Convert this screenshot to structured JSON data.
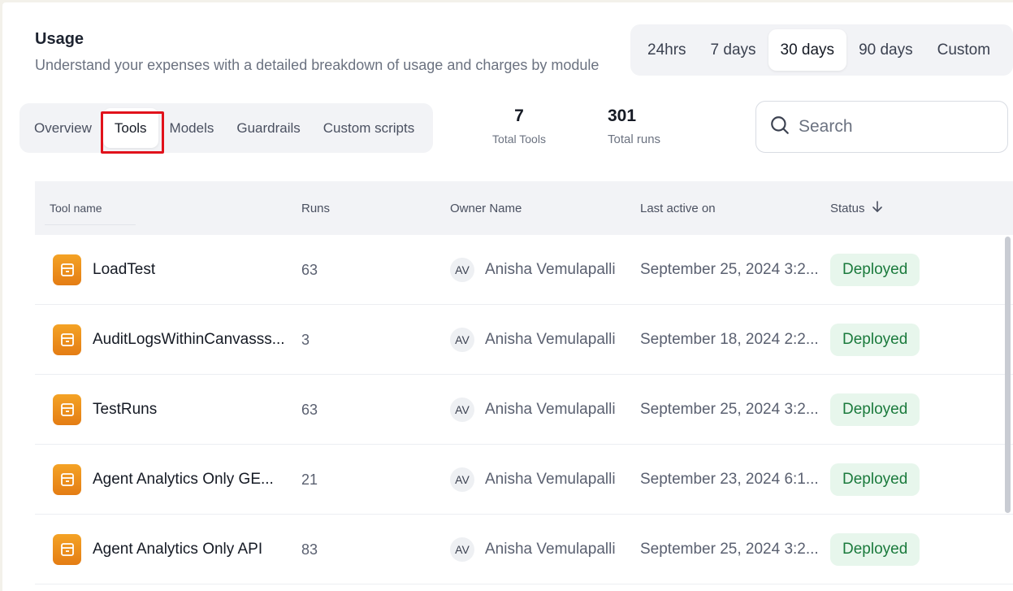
{
  "header": {
    "title": "Usage",
    "subtitle": "Understand your expenses with a detailed breakdown of usage and charges by module"
  },
  "time_range": {
    "options": [
      "24hrs",
      "7 days",
      "30 days",
      "90 days",
      "Custom"
    ],
    "selected": "30 days"
  },
  "tabs": {
    "items": [
      "Overview",
      "Tools",
      "Models",
      "Guardrails",
      "Custom scripts"
    ],
    "selected": "Tools"
  },
  "stats": {
    "total_tools": {
      "value": "7",
      "label": "Total Tools"
    },
    "total_runs": {
      "value": "301",
      "label": "Total runs"
    }
  },
  "search": {
    "placeholder": "Search",
    "value": ""
  },
  "table": {
    "columns": {
      "name": "Tool name",
      "runs": "Runs",
      "owner": "Owner Name",
      "last_active": "Last active on",
      "status": "Status"
    },
    "sort_icon": "arrow-down-icon",
    "rows": [
      {
        "name": "LoadTest",
        "runs": "63",
        "owner_initials": "AV",
        "owner": "Anisha Vemulapalli",
        "last_active": "September 25, 2024 3:2...",
        "status": "Deployed"
      },
      {
        "name": "AuditLogsWithinCanvasss...",
        "runs": "3",
        "owner_initials": "AV",
        "owner": "Anisha Vemulapalli",
        "last_active": "September 18, 2024 2:2...",
        "status": "Deployed"
      },
      {
        "name": "TestRuns",
        "runs": "63",
        "owner_initials": "AV",
        "owner": "Anisha Vemulapalli",
        "last_active": "September 25, 2024 3:2...",
        "status": "Deployed"
      },
      {
        "name": "Agent Analytics Only GE...",
        "runs": "21",
        "owner_initials": "AV",
        "owner": "Anisha Vemulapalli",
        "last_active": "September 23, 2024 6:1...",
        "status": "Deployed"
      },
      {
        "name": "Agent Analytics Only API",
        "runs": "83",
        "owner_initials": "AV",
        "owner": "Anisha Vemulapalli",
        "last_active": "September 25, 2024 3:2...",
        "status": "Deployed"
      }
    ]
  },
  "colors": {
    "accent_orange": "#e47d14",
    "status_green": "#1a7a3c",
    "highlight_red": "#e1121b"
  }
}
